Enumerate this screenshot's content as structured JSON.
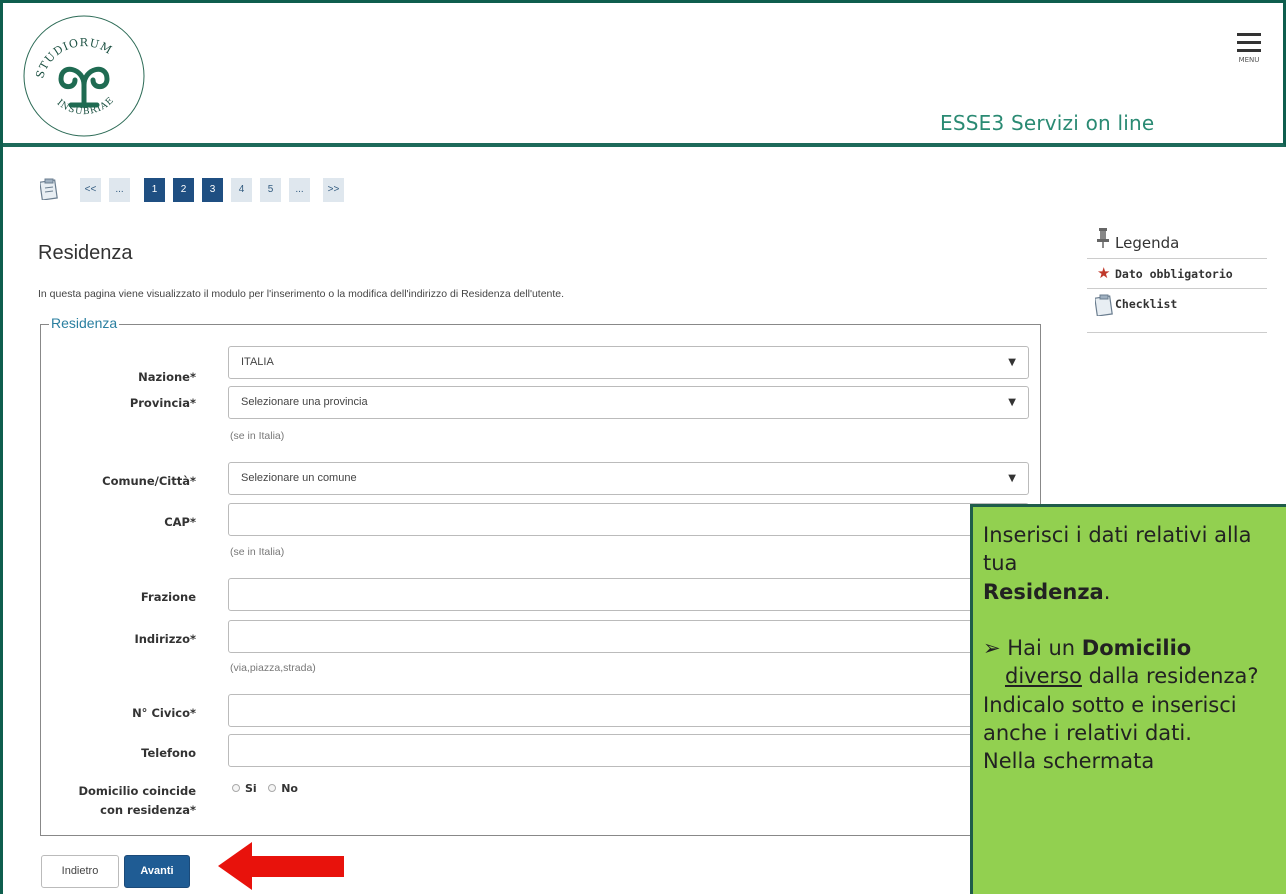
{
  "header": {
    "logo_text": "UNIVERSITAS STUDIORUM INSUBRIAE",
    "menu_label": "MENU",
    "service_title": "ESSE3 Servizi on line"
  },
  "pager": {
    "items": [
      "<<",
      "...",
      "1",
      "2",
      "3",
      "4",
      "5",
      "...",
      ">>"
    ],
    "current": "3"
  },
  "page": {
    "title": "Residenza",
    "description": "In questa pagina viene visualizzato il modulo per l'inserimento o la modifica dell'indirizzo di Residenza dell'utente."
  },
  "form": {
    "legend": "Residenza",
    "nazione": {
      "label": "Nazione*",
      "value": "ITALIA"
    },
    "provincia": {
      "label": "Provincia*",
      "value": "Selezionare una provincia",
      "hint": "(se in Italia)"
    },
    "comune": {
      "label": "Comune/Città*",
      "value": "Selezionare un comune"
    },
    "cap": {
      "label": "CAP*",
      "value": "",
      "hint": "(se in Italia)"
    },
    "frazione": {
      "label": "Frazione",
      "value": ""
    },
    "indirizzo": {
      "label": "Indirizzo*",
      "value": "",
      "hint": "(via,piazza,strada)"
    },
    "civico": {
      "label": "N° Civico*",
      "value": ""
    },
    "telefono": {
      "label": "Telefono",
      "value": ""
    },
    "domicilio": {
      "label_line1": "Domicilio coincide",
      "label_line2": "con residenza*",
      "option_yes": "Si",
      "option_no": "No"
    }
  },
  "buttons": {
    "back": "Indietro",
    "next": "Avanti"
  },
  "legenda": {
    "title": "Legenda",
    "items": [
      "Dato obbligatorio",
      "Checklist"
    ]
  },
  "note": {
    "line1": "Inserisci i dati relativi alla tua",
    "line1_bold": "Residenza",
    "line1_end": ".",
    "bullet_a": "Hai un",
    "bullet_bold": "Domicilio",
    "bullet_underline": "diverso",
    "bullet_b": "dalla residenza?",
    "line3": "Indicalo sotto e inserisci anche i relativi dati.",
    "line4": "Nella schermata"
  },
  "colors": {
    "brand_green": "#0f5e4e",
    "primary_blue": "#1f5c94",
    "note_green": "#92d050",
    "arrow_red": "#e8120c"
  }
}
